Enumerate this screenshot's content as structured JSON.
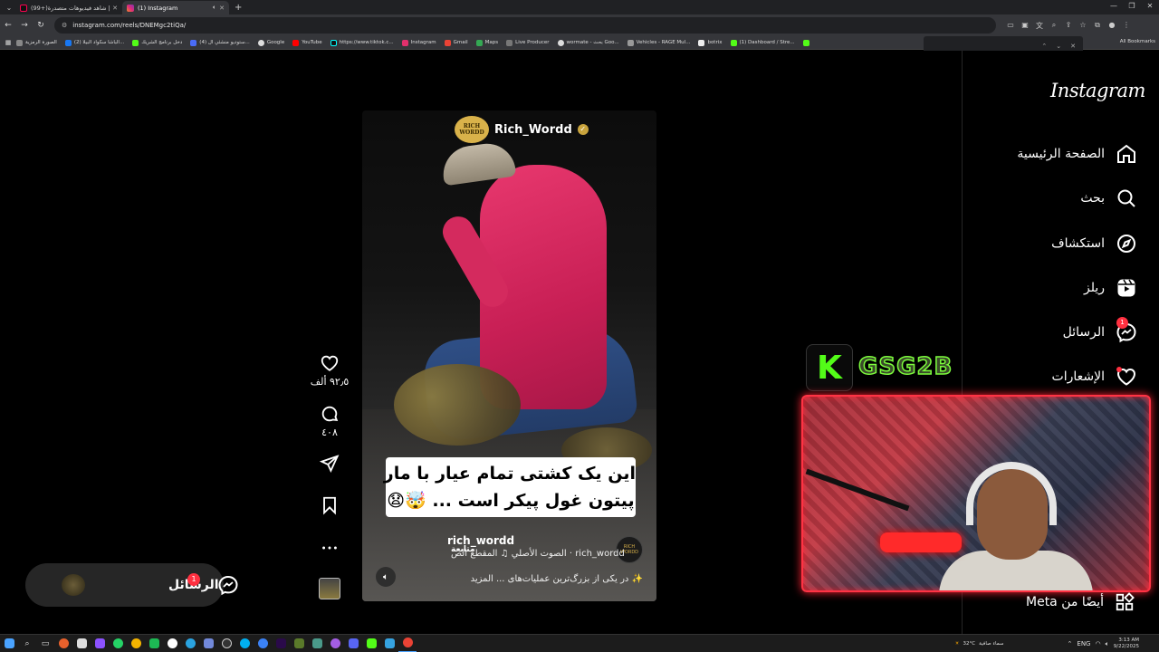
{
  "browser": {
    "tabs": [
      {
        "title": "(99+)شاهد فيديوهات متصدرة |",
        "active": false,
        "favicon_color": "#ff0050"
      },
      {
        "title": "(1) Instagram",
        "active": true,
        "favicon_color": "#e1306c"
      }
    ],
    "url": "instagram.com/reels/DNEMgc2tiQa/",
    "bookmarks": [
      {
        "label": "الصورة الرمزية",
        "color": "#888"
      },
      {
        "label": "(2) الباشا سكواد البيلا...",
        "color": "#1877f2"
      },
      {
        "label": "دخل برنامج الشريك",
        "color": "#53fc18"
      },
      {
        "label": "(4) ستوديو منشئي ال...",
        "color": "#4a6cf7"
      },
      {
        "label": "Google",
        "color": "#ddd"
      },
      {
        "label": "YouTube",
        "color": "#ff0000"
      },
      {
        "label": "https://www.tiktok.c...",
        "color": "#111"
      },
      {
        "label": "Instagram",
        "color": "#e1306c"
      },
      {
        "label": "Gmail",
        "color": "#ea4335"
      },
      {
        "label": "Maps",
        "color": "#34a853"
      },
      {
        "label": "Live Producer",
        "color": "#777"
      },
      {
        "label": "wormate - بحث Goo...",
        "color": "#ddd"
      },
      {
        "label": "Vehicles - RAGE Mul...",
        "color": "#999"
      },
      {
        "label": "botrix",
        "color": "#eee"
      },
      {
        "label": "(1) Dashboard / Stre...",
        "color": "#53fc18"
      }
    ],
    "all_bookmarks": "All Bookmarks"
  },
  "sidebar": {
    "logo": "Instagram",
    "items": [
      {
        "label": "الصفحة الرئيسية",
        "icon": "home-icon"
      },
      {
        "label": "بحث",
        "icon": "search-icon"
      },
      {
        "label": "استكشاف",
        "icon": "compass-icon"
      },
      {
        "label": "ريلز",
        "icon": "reels-icon"
      },
      {
        "label": "الرسائل",
        "icon": "messenger-icon",
        "badge": "1"
      },
      {
        "label": "الإشعارات",
        "icon": "heart-icon",
        "dot": true
      }
    ],
    "more": "أيضًا من Meta"
  },
  "reel": {
    "account_top": "Rich_Wordd",
    "logo_text": "RICH WORDD",
    "caption_line1": "این یک کشتی تمام عیار با مار",
    "caption_line2": "پیتون غول پیکر است ... 🤯😧",
    "account_bottom": "rich_wordd",
    "follow": "متابعة",
    "audio": "rich_wordd · الصوت الأصلي ♫ المقطع الص",
    "description": "✨ در یکی از بزرگ‌ترین عملیات‌های ... المزيد",
    "likes": "٩٢٫٥ ألف",
    "comments": "٤٠٨"
  },
  "messages_pill": {
    "label": "الرسائل",
    "badge": "1"
  },
  "overlay": {
    "channel_logo": "K",
    "channel_name": "GSG2B"
  },
  "taskbar": {
    "weather_temp": "32°C",
    "weather_text": "سماء صافية",
    "lang": "ENG",
    "time": "3:13 AM",
    "date": "9/22/2025"
  },
  "colors": {
    "accent_red": "#ff3040",
    "kick_green": "#53fc18"
  }
}
